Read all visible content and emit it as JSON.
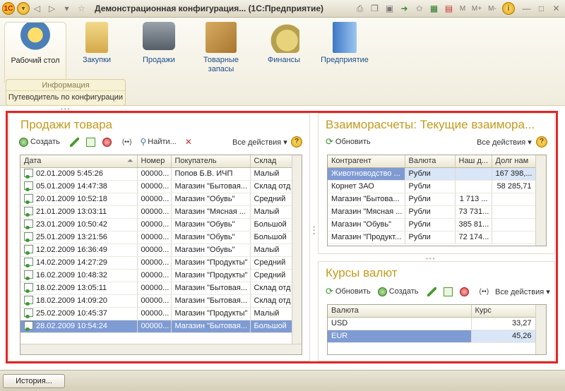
{
  "window": {
    "title": "Демонстрационная конфигурация... (1С:Предприятие)"
  },
  "sections": [
    {
      "label": "Рабочий стол"
    },
    {
      "label": "Закупки"
    },
    {
      "label": "Продажи"
    },
    {
      "label": "Товарные запасы"
    },
    {
      "label": "Финансы"
    },
    {
      "label": "Предприятие"
    }
  ],
  "info_group": {
    "header": "Информация",
    "link": "Путеводитель по конфигурации"
  },
  "sales": {
    "title": "Продажи товара",
    "create": "Создать",
    "find": "Найти...",
    "all_actions": "Все действия",
    "columns": [
      "Дата",
      "Номер",
      "Покупатель",
      "Склад"
    ],
    "rows": [
      [
        "02.01.2009 5:45:26",
        "00000...",
        "Попов Б.В. ИЧП",
        "Малый"
      ],
      [
        "05.01.2009 14:47:38",
        "00000...",
        "Магазин \"Бытовая...",
        "Склад отд"
      ],
      [
        "20.01.2009 10:52:18",
        "00000...",
        "Магазин \"Обувь\"",
        "Средний"
      ],
      [
        "21.01.2009 13:03:11",
        "00000...",
        "Магазин \"Мясная ...",
        "Малый"
      ],
      [
        "23.01.2009 10:50:42",
        "00000...",
        "Магазин \"Обувь\"",
        "Большой"
      ],
      [
        "25.01.2009 13:21:56",
        "00000...",
        "Магазин \"Обувь\"",
        "Большой"
      ],
      [
        "12.02.2009 16:36:49",
        "00000...",
        "Магазин \"Обувь\"",
        "Малый"
      ],
      [
        "14.02.2009 14:27:29",
        "00000...",
        "Магазин \"Продукты\"",
        "Средний"
      ],
      [
        "16.02.2009 10:48:32",
        "00000...",
        "Магазин \"Продукты\"",
        "Средний"
      ],
      [
        "18.02.2009 13:05:11",
        "00000...",
        "Магазин \"Бытовая...",
        "Склад отд"
      ],
      [
        "18.02.2009 14:09:20",
        "00000...",
        "Магазин \"Бытовая...",
        "Склад отд"
      ],
      [
        "25.02.2009 10:45:37",
        "00000...",
        "Магазин \"Продукты\"",
        "Малый"
      ],
      [
        "28.02.2009 10:54:24",
        "00000...",
        "Магазин \"Бытовая...",
        "Большой"
      ]
    ]
  },
  "settlements": {
    "title": "Взаиморасчеты: Текущие взаимора...",
    "refresh": "Обновить",
    "all_actions": "Все действия",
    "columns": [
      "Контрагент",
      "Валюта",
      "Наш д...",
      "Долг нам"
    ],
    "rows": [
      [
        "Животноводство ...",
        "Рубли",
        "",
        "167 398,..."
      ],
      [
        "Корнет ЗАО",
        "Рубли",
        "",
        "58 285,71"
      ],
      [
        "Магазин \"Бытова...",
        "Рубли",
        "1 713 ...",
        ""
      ],
      [
        "Магазин \"Мясная ...",
        "Рубли",
        "73 731...",
        ""
      ],
      [
        "Магазин \"Обувь\"",
        "Рубли",
        "385 81...",
        ""
      ],
      [
        "Магазин \"Продукт...",
        "Рубли",
        "72 174...",
        ""
      ]
    ]
  },
  "rates": {
    "title": "Курсы валют",
    "refresh": "Обновить",
    "create": "Создать",
    "all_actions": "Все действия",
    "columns": [
      "Валюта",
      "Курс"
    ],
    "rows": [
      [
        "USD",
        "33,27"
      ],
      [
        "EUR",
        "45,26"
      ]
    ]
  },
  "statusbar": {
    "history": "История..."
  },
  "toolbar_letters": [
    "M",
    "M+",
    "M-"
  ]
}
